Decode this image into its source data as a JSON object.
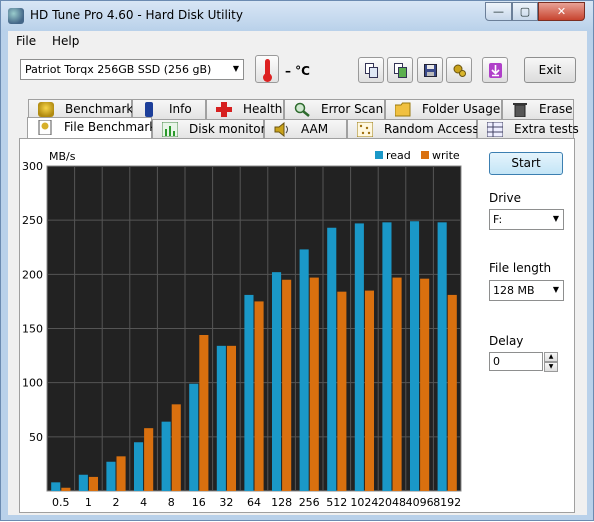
{
  "window": {
    "title": "HD Tune Pro 4.60 - Hard Disk Utility",
    "minimize": "—",
    "maximize": "▢",
    "close": "✕"
  },
  "menu": {
    "file": "File",
    "help": "Help"
  },
  "toolbar": {
    "drive": "Patriot Torqx 256GB SSD (256 gB)",
    "temperature": "– °C",
    "exit": "Exit"
  },
  "tabs_top": [
    "Benchmark",
    "Info",
    "Health",
    "Error Scan",
    "Folder Usage",
    "Erase"
  ],
  "tabs_bottom": [
    "File Benchmark",
    "Disk monitor",
    "AAM",
    "Random Access",
    "Extra tests"
  ],
  "side": {
    "start": "Start",
    "drive_label": "Drive",
    "drive_value": "F:",
    "file_length_label": "File length",
    "file_length_value": "128 MB",
    "delay_label": "Delay",
    "delay_value": "0"
  },
  "colors": {
    "read": "#1a98c8",
    "write": "#d9700f",
    "plot_bg": "#222222",
    "grid": "#555555"
  },
  "chart_data": {
    "type": "bar",
    "ylabel": "MB/s",
    "ylim": [
      0,
      300
    ],
    "yticks": [
      50,
      100,
      150,
      200,
      250,
      300
    ],
    "categories": [
      "0.5",
      "1",
      "2",
      "4",
      "8",
      "16",
      "32",
      "64",
      "128",
      "256",
      "512",
      "1024",
      "2048",
      "4096",
      "8192"
    ],
    "series": [
      {
        "name": "read",
        "values": [
          8,
          15,
          27,
          45,
          64,
          99,
          134,
          181,
          202,
          223,
          243,
          247,
          248,
          249,
          248
        ]
      },
      {
        "name": "write",
        "values": [
          3,
          13,
          32,
          58,
          80,
          144,
          134,
          175,
          195,
          197,
          184,
          185,
          197,
          196,
          181
        ]
      }
    ],
    "legend_position": "top-right",
    "grid": true
  }
}
